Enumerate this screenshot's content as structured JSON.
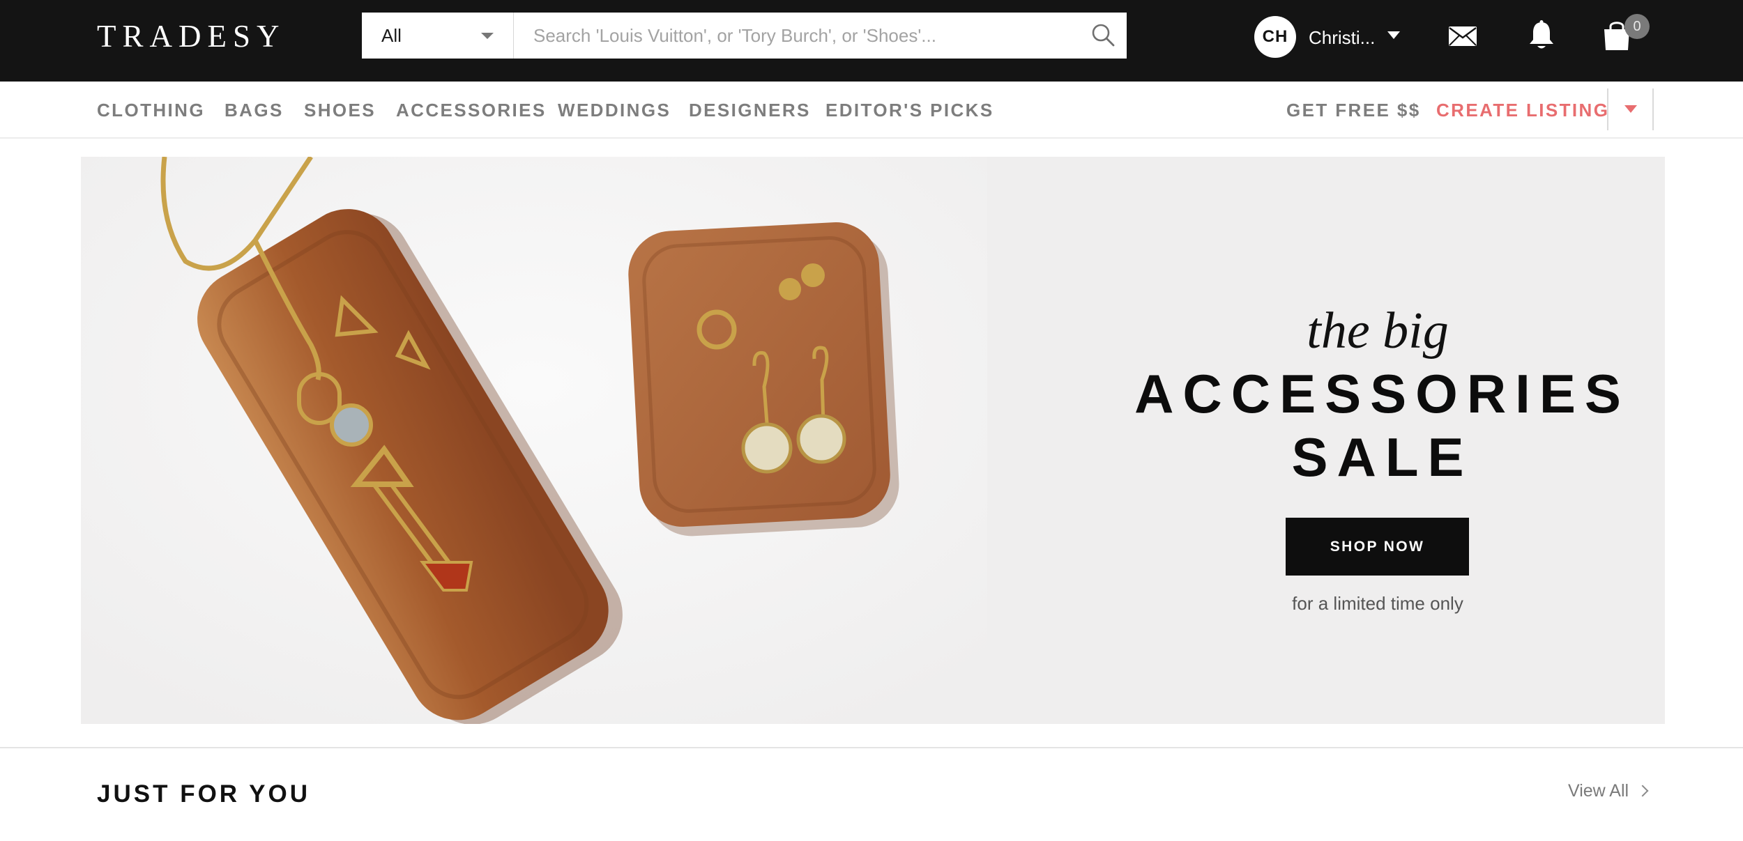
{
  "header": {
    "logo": "TRADESY",
    "search": {
      "category": "All",
      "placeholder": "Search 'Louis Vuitton', or 'Tory Burch', or 'Shoes'..."
    },
    "user": {
      "initials": "CH",
      "name": "Christi..."
    },
    "cart_count": "0"
  },
  "nav": {
    "items": [
      "CLOTHING",
      "BAGS",
      "SHOES",
      "ACCESSORIES",
      "WEDDINGS",
      "DESIGNERS",
      "EDITOR'S PICKS"
    ],
    "get_free": "GET FREE $$",
    "create_listing": "CREATE LISTING"
  },
  "hero": {
    "subtitle": "the big",
    "title_line1": "ACCESSORIES",
    "title_line2": "SALE",
    "cta": "SHOP NOW",
    "note": "for a limited time only"
  },
  "section": {
    "title": "JUST FOR YOU",
    "view_all": "View All"
  },
  "colors": {
    "topbar": "#141414",
    "accent": "#e86d6f",
    "hero_bg": "#efeeee",
    "wood": "#a0522d"
  }
}
